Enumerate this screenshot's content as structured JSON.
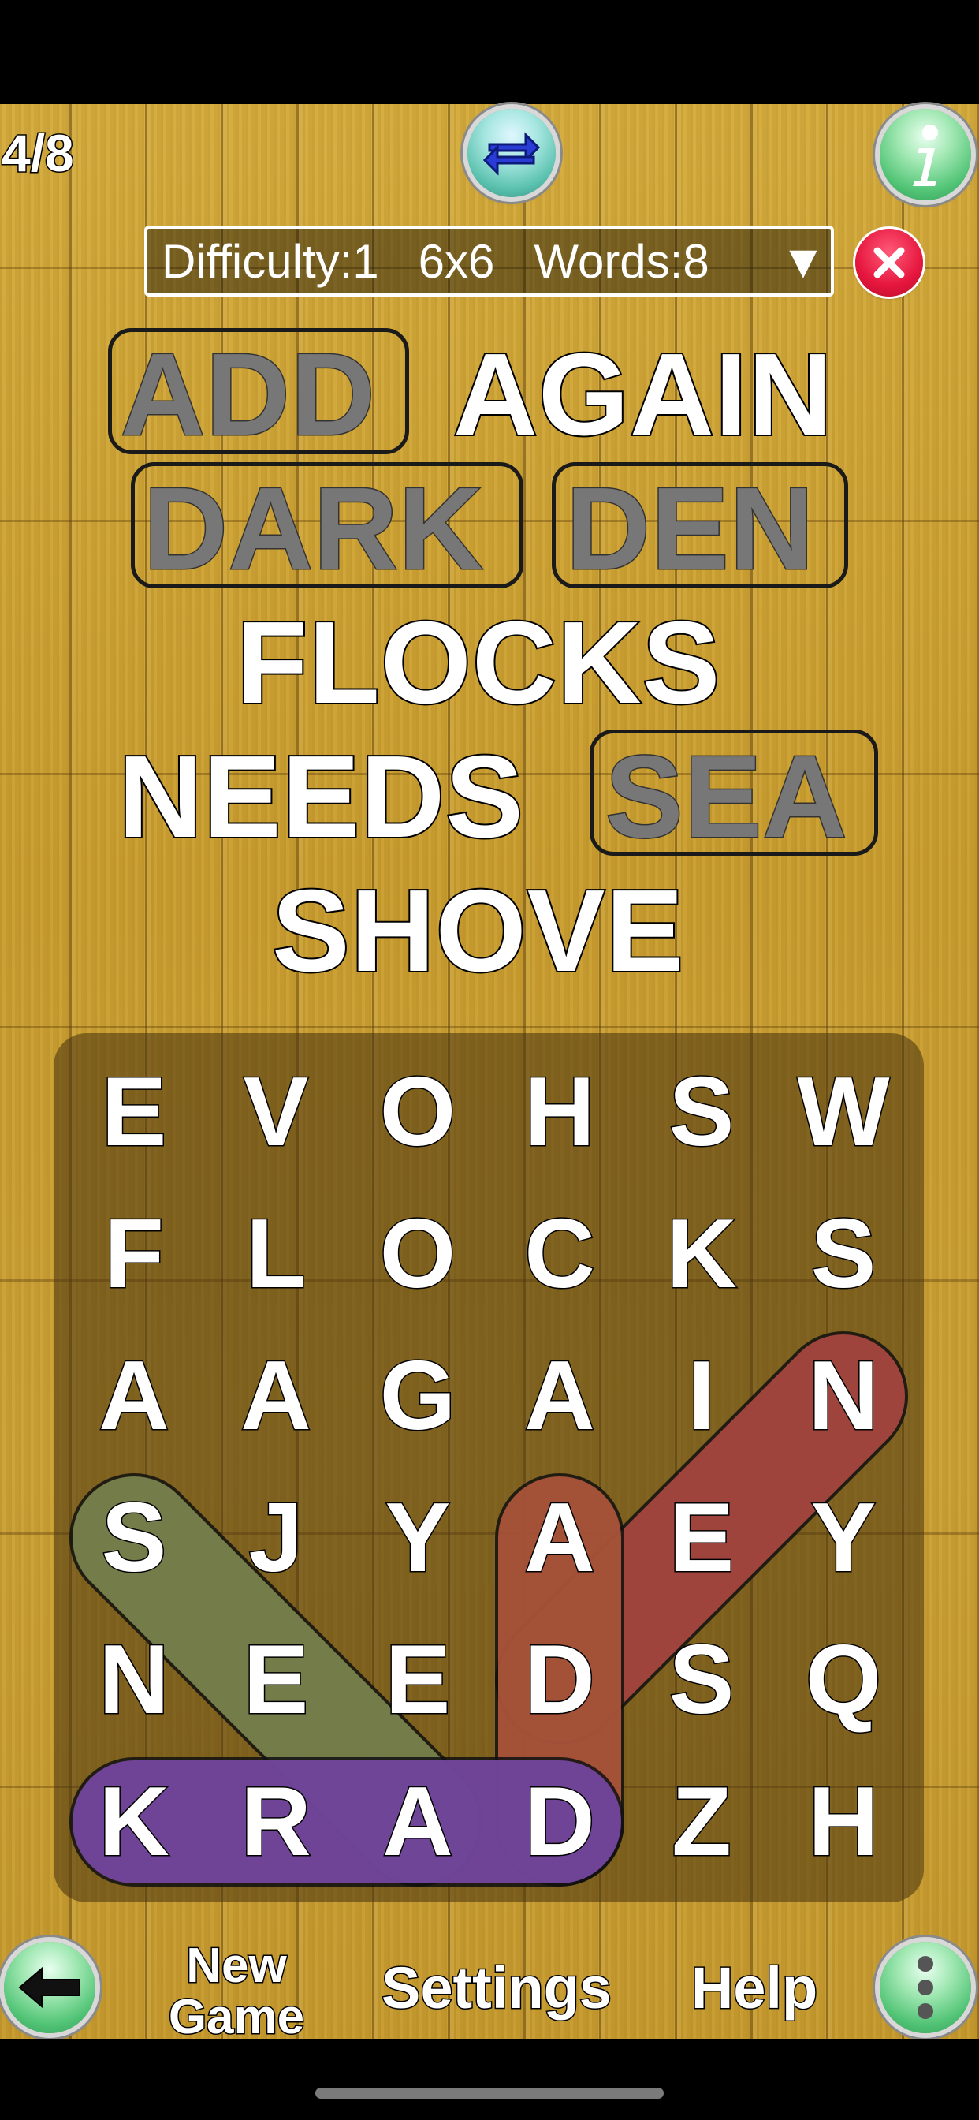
{
  "header": {
    "counter": "4/8"
  },
  "difficulty": {
    "label": "Difficulty:1   6x6   Words:8",
    "arrow": "▼"
  },
  "words": [
    {
      "text": "ADD",
      "found": true
    },
    {
      "text": "AGAIN",
      "found": false
    },
    {
      "text": "DARK",
      "found": true
    },
    {
      "text": "DEN",
      "found": true
    },
    {
      "text": "FLOCKS",
      "found": false
    },
    {
      "text": "NEEDS",
      "found": false
    },
    {
      "text": "SEA",
      "found": true
    },
    {
      "text": "SHOVE",
      "found": false
    }
  ],
  "grid": [
    [
      "E",
      "V",
      "O",
      "H",
      "S",
      "W"
    ],
    [
      "F",
      "L",
      "O",
      "C",
      "K",
      "S"
    ],
    [
      "A",
      "A",
      "G",
      "A",
      "I",
      "N"
    ],
    [
      "S",
      "J",
      "Y",
      "A",
      "E",
      "Y"
    ],
    [
      "N",
      "E",
      "E",
      "D",
      "S",
      "Q"
    ],
    [
      "K",
      "R",
      "A",
      "D",
      "Z",
      "H"
    ]
  ],
  "highlights": [
    {
      "word": "SEA",
      "from": [
        3,
        0
      ],
      "to": [
        5,
        2
      ],
      "color": "#7f8a52"
    },
    {
      "word": "DEN",
      "from": [
        4,
        3
      ],
      "to": [
        2,
        5
      ],
      "color": "#b04a42"
    },
    {
      "word": "ADD",
      "from": [
        3,
        3
      ],
      "to": [
        5,
        3
      ],
      "color": "#b5593c"
    },
    {
      "word": "DARK",
      "from": [
        5,
        3
      ],
      "to": [
        5,
        0
      ],
      "color": "#7a4aa8"
    }
  ],
  "bottom": {
    "new_game": "New Game",
    "settings": "Settings",
    "help": "Help"
  }
}
